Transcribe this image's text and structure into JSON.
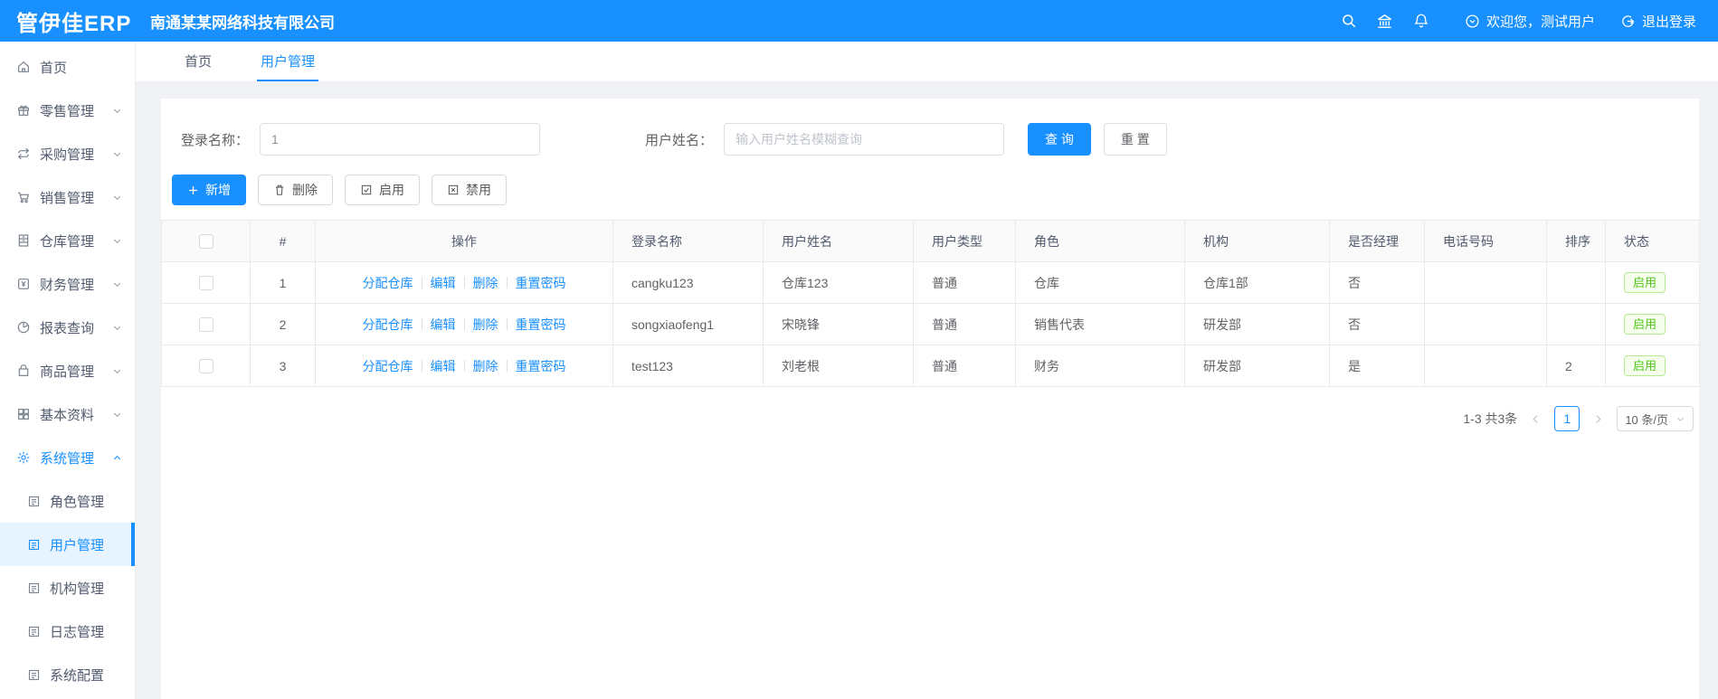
{
  "header": {
    "logo": "管伊佳ERP",
    "company": "南通某某网络科技有限公司",
    "welcome": "欢迎您，测试用户",
    "logout": "退出登录"
  },
  "tabs": {
    "home": "首页",
    "current": "用户管理"
  },
  "sidebar": {
    "items": [
      {
        "label": "首页"
      },
      {
        "label": "零售管理"
      },
      {
        "label": "采购管理"
      },
      {
        "label": "销售管理"
      },
      {
        "label": "仓库管理"
      },
      {
        "label": "财务管理"
      },
      {
        "label": "报表查询"
      },
      {
        "label": "商品管理"
      },
      {
        "label": "基本资料"
      },
      {
        "label": "系统管理"
      }
    ],
    "sub_items": [
      {
        "label": "角色管理"
      },
      {
        "label": "用户管理"
      },
      {
        "label": "机构管理"
      },
      {
        "label": "日志管理"
      },
      {
        "label": "系统配置"
      }
    ]
  },
  "filters": {
    "login_label": "登录名称：",
    "login_value": "1",
    "name_label": "用户姓名：",
    "name_placeholder": "输入用户姓名模糊查询",
    "query": "查 询",
    "reset": "重 置"
  },
  "toolbar": {
    "add": "新增",
    "delete": "删除",
    "enable": "启用",
    "disable": "禁用"
  },
  "table": {
    "headers": [
      "#",
      "操作",
      "登录名称",
      "用户姓名",
      "用户类型",
      "角色",
      "机构",
      "是否经理",
      "电话号码",
      "排序",
      "状态"
    ],
    "actions": {
      "assign": "分配仓库",
      "edit": "编辑",
      "del": "删除",
      "reset_pwd": "重置密码"
    },
    "rows": [
      {
        "index": "1",
        "login": "cangku123",
        "name": "仓库123",
        "type": "普通",
        "role": "仓库",
        "org": "仓库1部",
        "manager": "否",
        "phone": "",
        "sort": "",
        "status": "启用"
      },
      {
        "index": "2",
        "login": "songxiaofeng1",
        "name": "宋晓锋",
        "type": "普通",
        "role": "销售代表",
        "org": "研发部",
        "manager": "否",
        "phone": "",
        "sort": "",
        "status": "启用"
      },
      {
        "index": "3",
        "login": "test123",
        "name": "刘老根",
        "type": "普通",
        "role": "财务",
        "org": "研发部",
        "manager": "是",
        "phone": "",
        "sort": "2",
        "status": "启用"
      }
    ]
  },
  "pagination": {
    "total": "1-3 共3条",
    "page": "1",
    "page_size": "10 条/页"
  },
  "colors": {
    "primary": "#1890ff",
    "success": "#52c41a"
  }
}
